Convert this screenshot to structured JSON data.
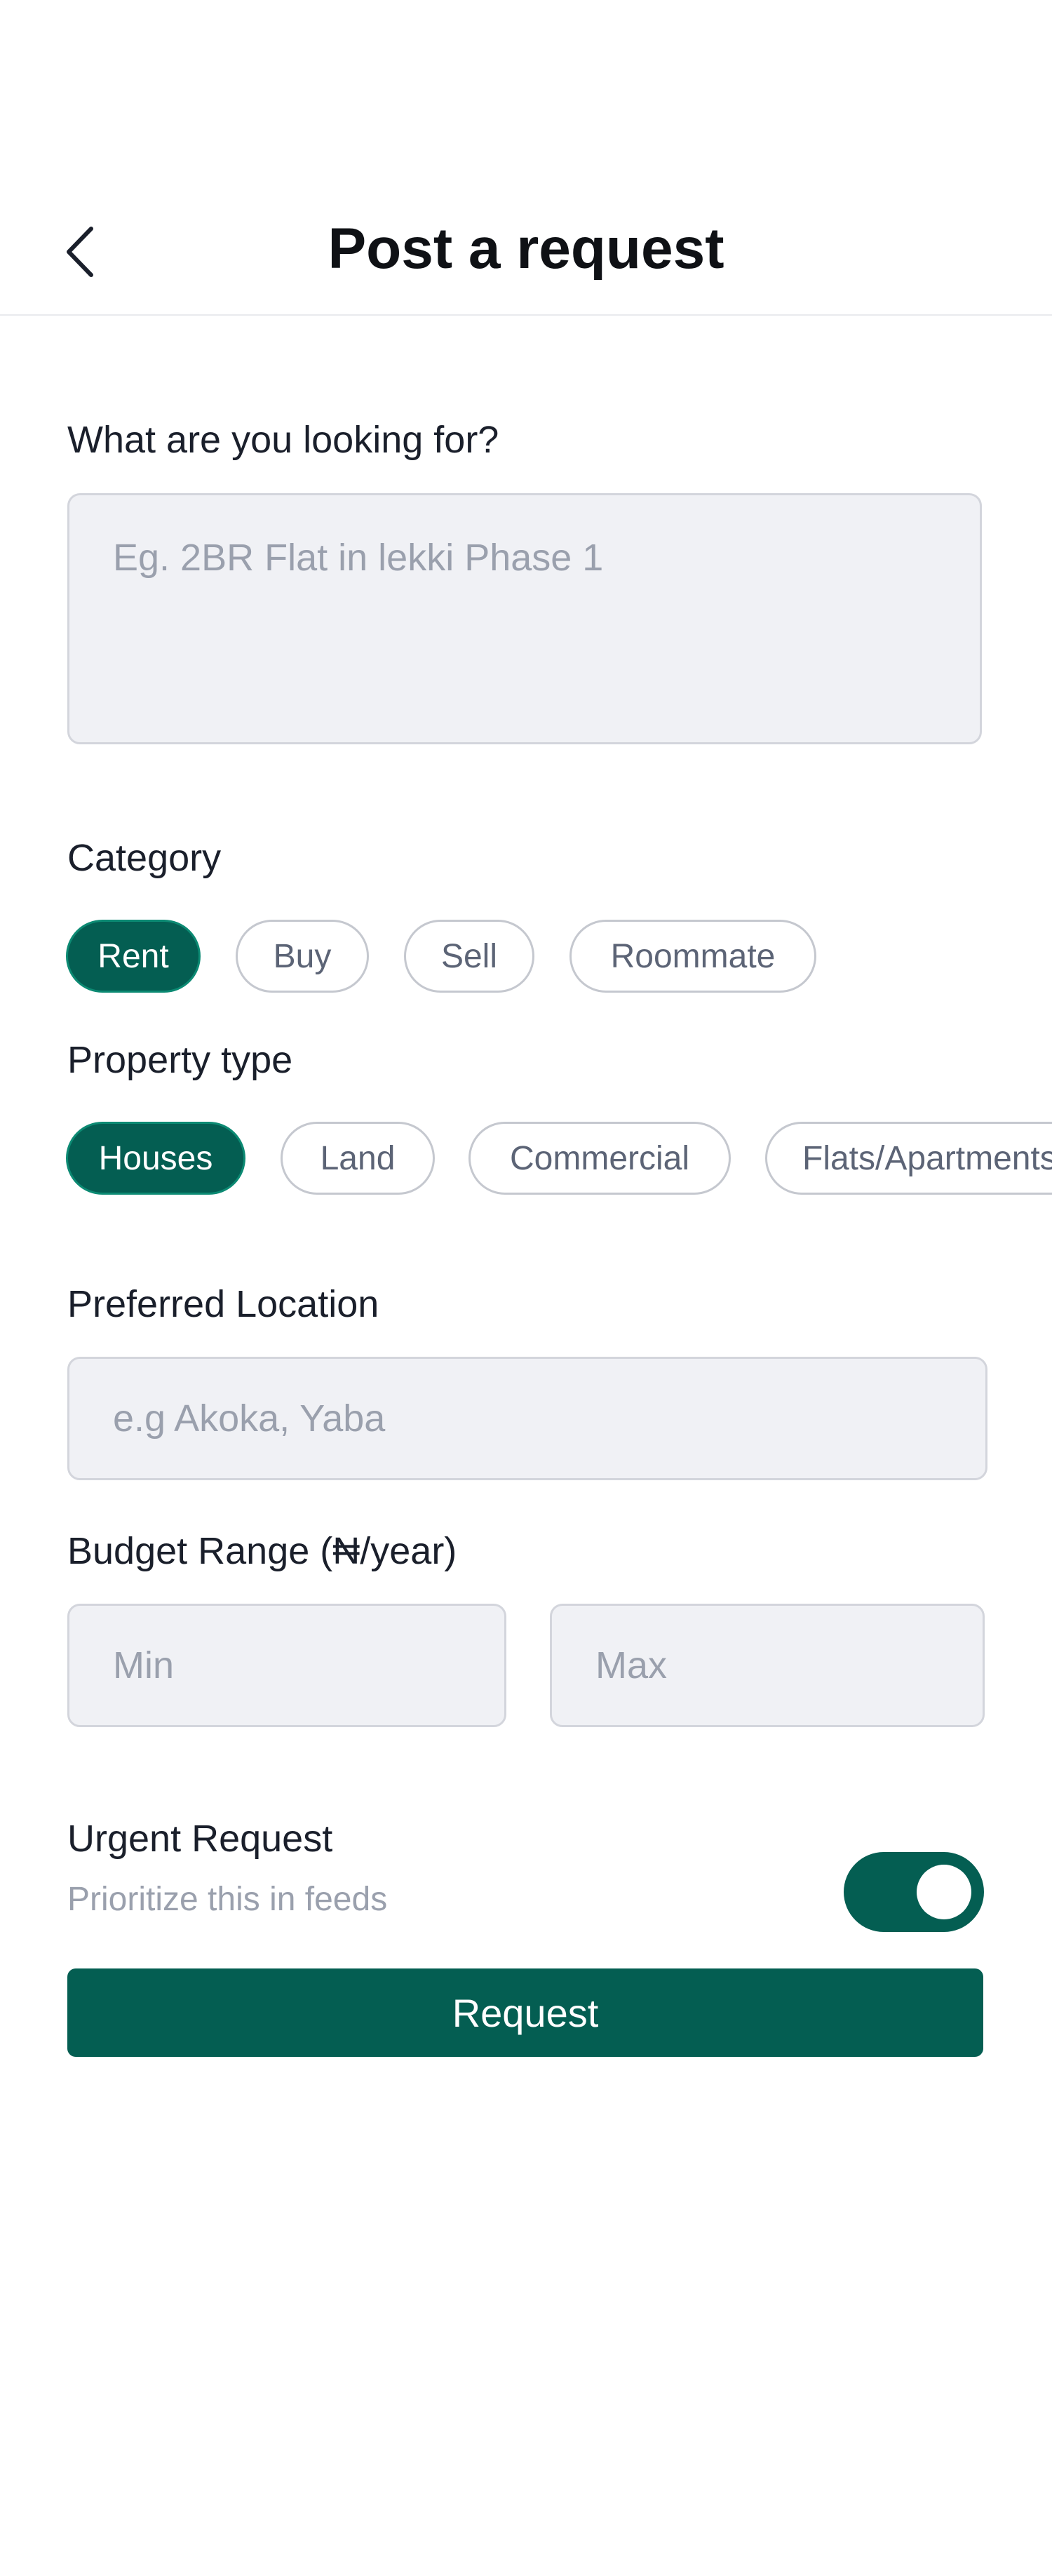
{
  "header": {
    "title": "Post a request",
    "back_icon": "chevron-left-icon"
  },
  "form": {
    "looking_for": {
      "label": "What are you looking for?",
      "placeholder": "Eg. 2BR Flat in lekki Phase 1"
    },
    "category": {
      "label": "Category",
      "options": [
        "Rent",
        "Buy",
        "Sell",
        "Roommate"
      ],
      "selected": "Rent"
    },
    "property_type": {
      "label": "Property type",
      "options": [
        "Houses",
        "Land",
        "Commercial",
        "Flats/Apartments"
      ],
      "selected": "Houses"
    },
    "location": {
      "label": "Preferred Location",
      "placeholder": "e.g Akoka, Yaba"
    },
    "budget": {
      "label": "Budget Range (₦/year)",
      "min_placeholder": "Min",
      "max_placeholder": "Max"
    },
    "urgent": {
      "label": "Urgent Request",
      "description": "Prioritize this in feeds",
      "enabled": true
    },
    "submit_label": "Request"
  },
  "colors": {
    "accent": "#045e52",
    "input_bg": "#f0f1f5",
    "placeholder": "#9aa0ad"
  }
}
